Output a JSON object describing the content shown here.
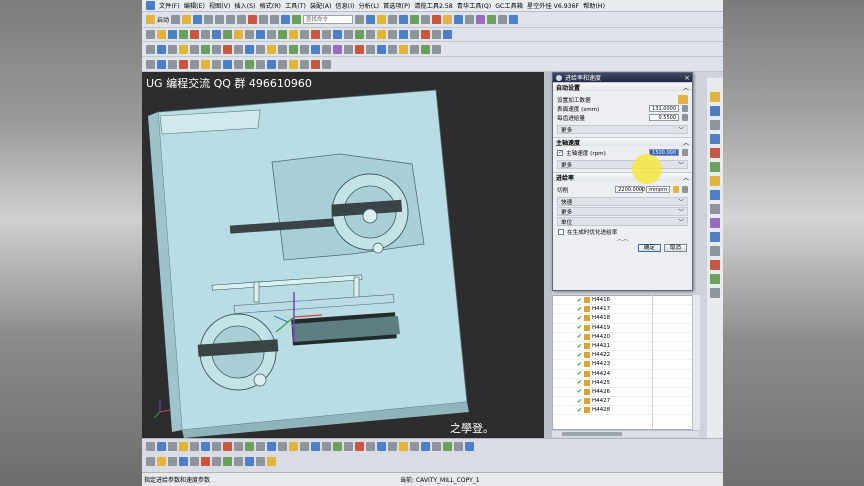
{
  "menu": {
    "items": [
      "文件(F)",
      "编辑(E)",
      "视图(V)",
      "插入(S)",
      "格式(R)",
      "工具(T)",
      "装配(A)",
      "信息(I)",
      "分析(L)",
      "首选项(P)",
      "清揽工具2.58",
      "青华工具(Q)",
      "GC工具箱",
      "星空外挂 V6.936F",
      "帮助(H)"
    ]
  },
  "toolbar": {
    "start_label": "启动",
    "command_placeholder": "查找命令"
  },
  "viewport": {
    "watermark": "UG 编程交流 QQ 群 496610960",
    "corner_text": "之學登。",
    "axis_labels": [
      "XM",
      "ZM",
      "YM",
      "XC",
      "YC"
    ]
  },
  "dialog": {
    "title": "进给率和速度",
    "groups": {
      "auto": {
        "title": "自动设置",
        "set_data_label": "设置加工数据",
        "surface_speed_label": "表面速度 (smm)",
        "surface_speed_value": "131.0000",
        "feed_per_tooth_label": "每齿进给量",
        "feed_per_tooth_value": "0.5500",
        "more_label": "更多"
      },
      "spindle": {
        "title": "主轴速度",
        "spindle_speed_label": "主轴速度 (rpm)",
        "spindle_speed_value": "1500.000",
        "spindle_checked": true,
        "more_label": "更多"
      },
      "feed": {
        "title": "进给率",
        "cut_label": "切削",
        "cut_value": "2200.0000",
        "cut_unit": "mmpm",
        "rows": [
          "快速",
          "更多",
          "单位"
        ],
        "optimize_label": "在生成时优化进给率",
        "optimize_checked": false
      }
    },
    "ok_label": "确定",
    "cancel_label": "取消"
  },
  "operation_list": {
    "rows": [
      "H4416",
      "H4417",
      "H4418",
      "H4419",
      "H4420",
      "H4421",
      "H4422",
      "H4423",
      "H4424",
      "H4425",
      "H4426",
      "H4427",
      "H4428"
    ]
  },
  "status": {
    "left": "指定进给参数和速度参数",
    "middle": "当前: CAVITY_MILL_COPY_1"
  },
  "colors": {
    "part_surface": "#b9dde2",
    "viewport_bg": "#2d2d2f",
    "highlight": "#f4e83e",
    "dialog_title": "#1f2b40"
  }
}
